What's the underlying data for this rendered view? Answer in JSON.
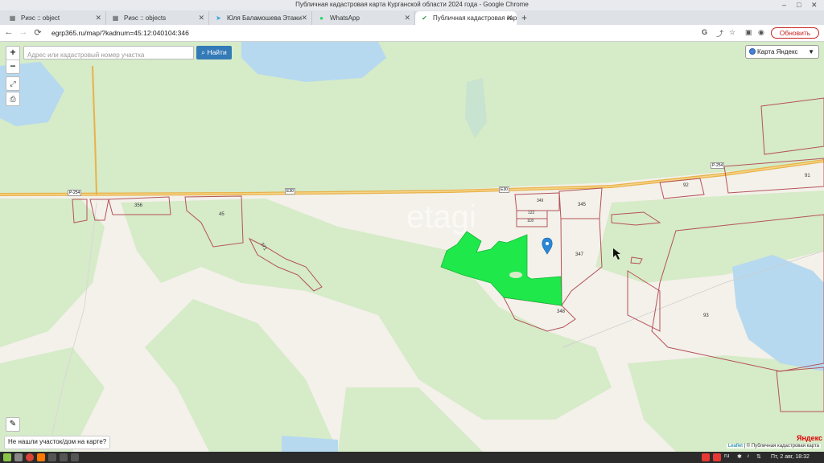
{
  "window": {
    "title": "Публичная кадастровая карта Курганской области 2024 года - Google Chrome"
  },
  "tabs": [
    {
      "label": "Риэс :: object",
      "icon": "grid-icon"
    },
    {
      "label": "Риэс :: objects",
      "icon": "grid-icon"
    },
    {
      "label": "Юля Баламошева Этажи",
      "icon": "telegram-icon"
    },
    {
      "label": "WhatsApp",
      "icon": "whatsapp-icon"
    },
    {
      "label": "Публичная кадастровая карт",
      "icon": "checkmark-icon",
      "active": true
    }
  ],
  "toolbar": {
    "url": "egrp365.ru/map/?kadnum=45:12:040104:346",
    "update_label": "Обновить"
  },
  "map": {
    "search_placeholder": "Адрес или кадастровый номер участка",
    "find_label": "Найти",
    "layer_label": "Карта Яндекс",
    "not_found_label": "Не нашли участок/дом на карте?",
    "attribution_leaflet": "Leaflet",
    "attribution_rest": "| © Публичная кадастровая карта",
    "yandex_logo": "Яндекс",
    "watermark": "etagi",
    "road_labels": [
      "Р-254",
      "Е30",
      "Е30",
      "Р-254"
    ],
    "parcel_labels": [
      "356",
      "45",
      "371",
      "349",
      "345",
      "122",
      "118",
      "347",
      "348",
      "92",
      "91",
      "93"
    ],
    "selected_parcel": "45:12:040104:346"
  },
  "taskbar": {
    "lang": "ru",
    "clock": "Пт, 2 авг, 18:32"
  },
  "colors": {
    "map_bg": "#f3f1ea",
    "forest": "#d6ebc8",
    "water": "#b6d9f0",
    "road": "#e8b24a",
    "parcel_border": "#b5525a",
    "selected_fill": "#1ee84a",
    "find_button": "#337ab7"
  }
}
